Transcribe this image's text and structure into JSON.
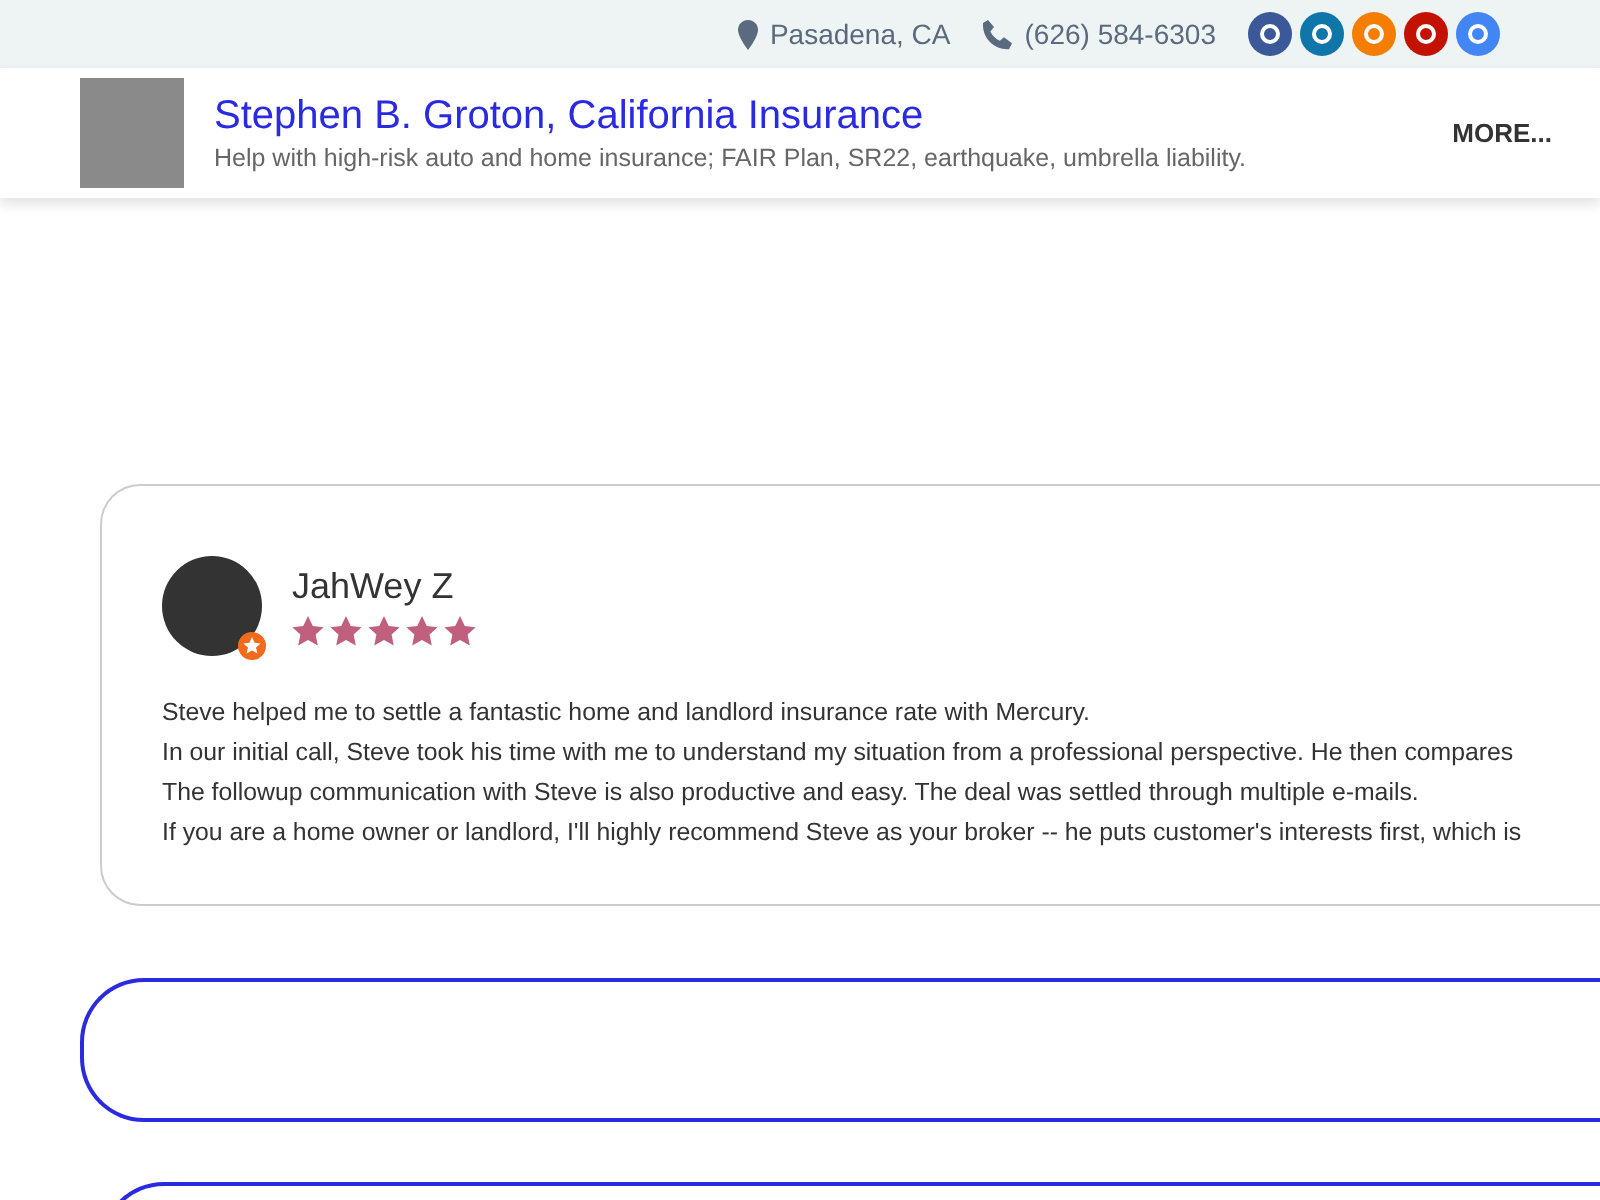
{
  "topbar": {
    "location": "Pasadena, CA",
    "phone": "(626) 584-6303",
    "social": [
      {
        "color": "#3b5998"
      },
      {
        "color": "#0e76a8"
      },
      {
        "color": "#f57d00"
      },
      {
        "color": "#c41200"
      },
      {
        "color": "#4285f4"
      }
    ]
  },
  "header": {
    "title": "Stephen B. Groton, California Insurance",
    "tagline": "Help with high-risk auto and home insurance; FAIR Plan, SR22, earthquake, umbrella liability.",
    "menu": "MORE..."
  },
  "review": {
    "author": "JahWey Z",
    "stars": 5,
    "lines": [
      "Steve helped me to settle a fantastic home and landlord insurance rate with Mercury.",
      "In our initial call, Steve took his time with me to understand my situation from a professional perspective. He then compares",
      "The followup communication with Steve is also productive and easy. The deal was settled through multiple e-mails.",
      "If you are a home owner or landlord, I'll highly recommend Steve as your broker -- he puts customer's interests first, which is"
    ]
  },
  "panels": [
    {
      "kind": "outline"
    },
    {
      "kind": "outline"
    }
  ]
}
